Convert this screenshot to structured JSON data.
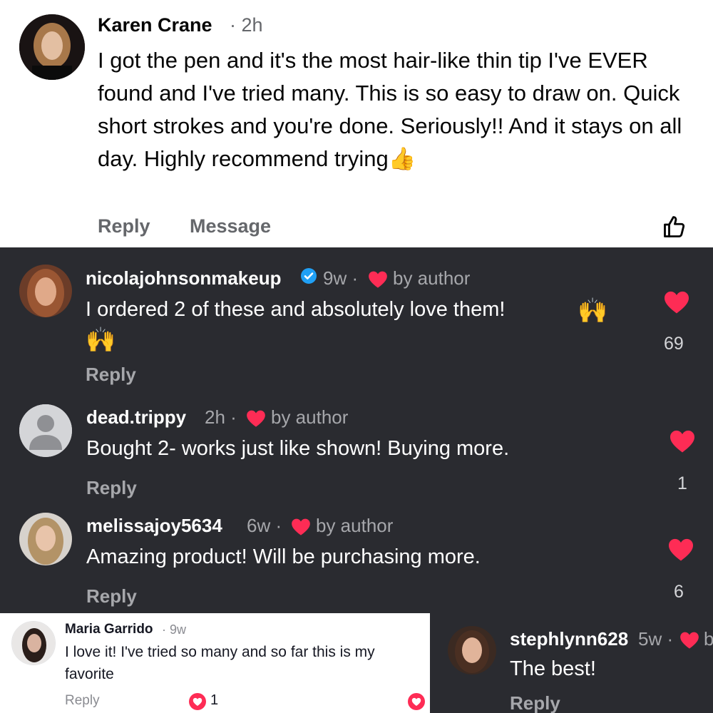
{
  "panel1": {
    "author": "Karen Crane",
    "time": "· 2h",
    "text": "I got the pen and it's the most hair-like thin tip I've EVER found and I've tried many. This is so easy to draw on. Quick short strokes and you're done. Seriously!! And it stays on all day. Highly recommend trying",
    "emoji": "👍",
    "reply": "Reply",
    "message": "Message"
  },
  "panel2": {
    "comments": [
      {
        "username": "nicolajohnsonmakeup",
        "time": "9w ·",
        "by_author": "by author",
        "text_line1": "I ordered 2 of these and absolutely love them!",
        "emoji": "🙌",
        "reply": "Reply",
        "likes": "69"
      },
      {
        "username": "dead.trippy",
        "time": "2h ·",
        "by_author": "by author",
        "text": "Bought 2- works just like shown! Buying more.",
        "reply": "Reply",
        "likes": "1"
      },
      {
        "username": "melissajoy5634",
        "time": "6w ·",
        "by_author": "by author",
        "text": "Amazing product! Will be purchasing more.",
        "reply": "Reply",
        "likes": "6"
      }
    ]
  },
  "panel3": {
    "username": "Maria Garrido",
    "time": "· 9w",
    "text_line1": "I love it! I've tried so many and so far this is my",
    "text_line2": "favorite",
    "reply": "Reply",
    "likes": "1"
  },
  "panel4": {
    "username": "stephlynn628",
    "time": "5w ·",
    "by_author": "b",
    "text": "The best!",
    "reply": "Reply"
  },
  "colors": {
    "heart_red": "#fe2c55",
    "verified_blue": "#20a0f5",
    "dark_bg": "#2a2b30"
  }
}
